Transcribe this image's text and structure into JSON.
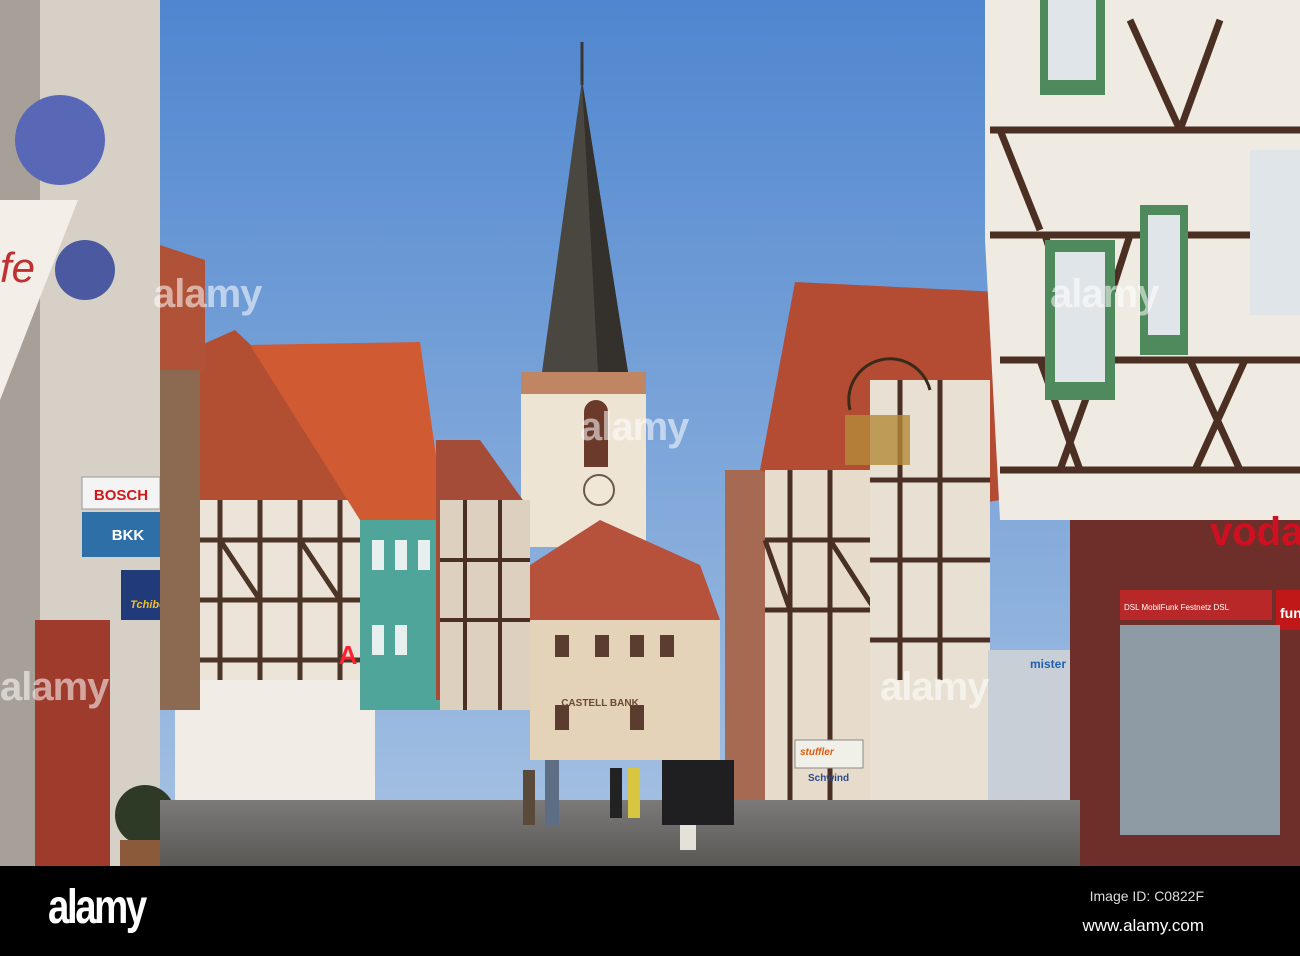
{
  "watermark": "alamy",
  "footer": {
    "logo": "alamy",
    "image_id": "Image ID: C0822F",
    "website": "www.alamy.com"
  },
  "signs": {
    "bosch": "BOSCH",
    "bkk": "BKK",
    "tchibo": "Tchibo",
    "bank": "CASTELL BANK",
    "stuffler": "stuffler",
    "schwind": "Schwind",
    "vodafone": "voda",
    "mobile_banner": "DSL   MobilFunk   Festnetz   DSL",
    "fun": "fun",
    "mister": "mister",
    "cafe": "fe"
  },
  "colors": {
    "sky_top": "#4f86cf",
    "sky_bottom": "#a8c3e3",
    "roof": "#c0553a",
    "vodafone_red": "#d01020"
  }
}
